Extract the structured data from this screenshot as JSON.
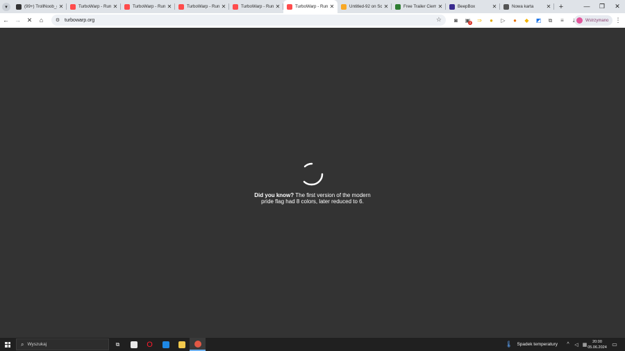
{
  "browser": {
    "tabs": [
      {
        "title": "(99+) TrollNoob_(",
        "favicon": "scratch-favicon",
        "color": "#333333"
      },
      {
        "title": "TurboWarp - Run",
        "favicon": "turbowarp-favicon",
        "color": "#ff4c4c"
      },
      {
        "title": "TurboWarp - Run",
        "favicon": "turbowarp-favicon",
        "color": "#ff4c4c"
      },
      {
        "title": "TurboWarp - Run",
        "favicon": "turbowarp-favicon",
        "color": "#ff4c4c"
      },
      {
        "title": "TurboWarp - Run",
        "favicon": "turbowarp-favicon",
        "color": "#ff4c4c"
      },
      {
        "title": "TurboWarp - Run",
        "favicon": "turbowarp-favicon",
        "color": "#ff4c4c",
        "active": true
      },
      {
        "title": "Untitled-92 on Sc",
        "favicon": "scratch-favicon",
        "color": "#f9a825"
      },
      {
        "title": "Free Trailer Ciem",
        "favicon": "site-favicon",
        "color": "#2e7d32"
      },
      {
        "title": "BeepBox",
        "favicon": "beepbox-favicon",
        "color": "#3a2b8f"
      },
      {
        "title": "Nowa karta",
        "favicon": "chrome-favicon",
        "color": "#555555"
      }
    ],
    "close_glyph": "✕",
    "new_tab_glyph": "+",
    "window_controls": {
      "minimize": "—",
      "restore": "❐",
      "close": "✕"
    },
    "url": "turbowarp.org",
    "profile_label": "Wstrzymano"
  },
  "page": {
    "tip_bold": "Did you know?",
    "tip_line1": " The first version of the modern",
    "tip_line2": "pride flag had 8 colors, later reduced to 6."
  },
  "taskbar": {
    "search_placeholder": "Wyszukaj",
    "weather": "Spadek temperatury",
    "time": "20:00",
    "date": "05.06.2024"
  }
}
